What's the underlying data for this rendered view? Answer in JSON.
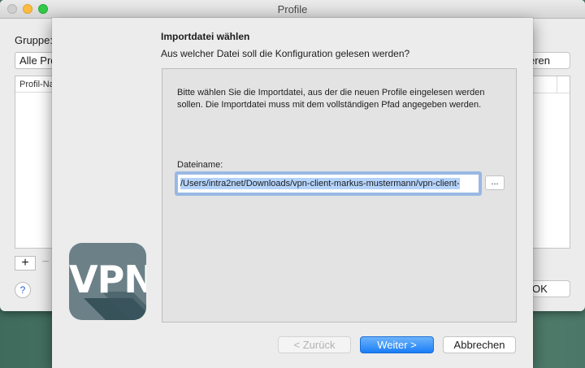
{
  "window": {
    "title": "Profile"
  },
  "parent": {
    "group_label": "Gruppe:",
    "group_value": "Alle Pro",
    "list_header": "Profil-Na",
    "add_label": "+",
    "remove_label": "−",
    "help_label": "?",
    "right_button_label": "eren",
    "ok_label": "OK"
  },
  "sheet": {
    "heading": "Importdatei wählen",
    "question": "Aus welcher Datei soll die Konfiguration gelesen werden?",
    "description": "Bitte wählen Sie die Importdatei, aus der die neuen Profile eingelesen werden sollen. Die Importdatei muss mit dem vollständigen Pfad angegeben werden.",
    "filename_label": "Dateiname:",
    "filename_value": "/Users/intra2net/Downloads/vpn-client-markus-mustermann/vpn-client-",
    "browse_label": "...",
    "logo_text": "VPN",
    "buttons": {
      "back": "< Zurück",
      "next": "Weiter >",
      "cancel": "Abbrechen"
    }
  },
  "colors": {
    "accent": "#1c7ef6",
    "selection": "#b4d3fb",
    "logo": "#6c8088"
  },
  "icons": [
    "close-light",
    "minimize-light",
    "zoom-light",
    "vpn-logo-icon",
    "help-icon"
  ]
}
